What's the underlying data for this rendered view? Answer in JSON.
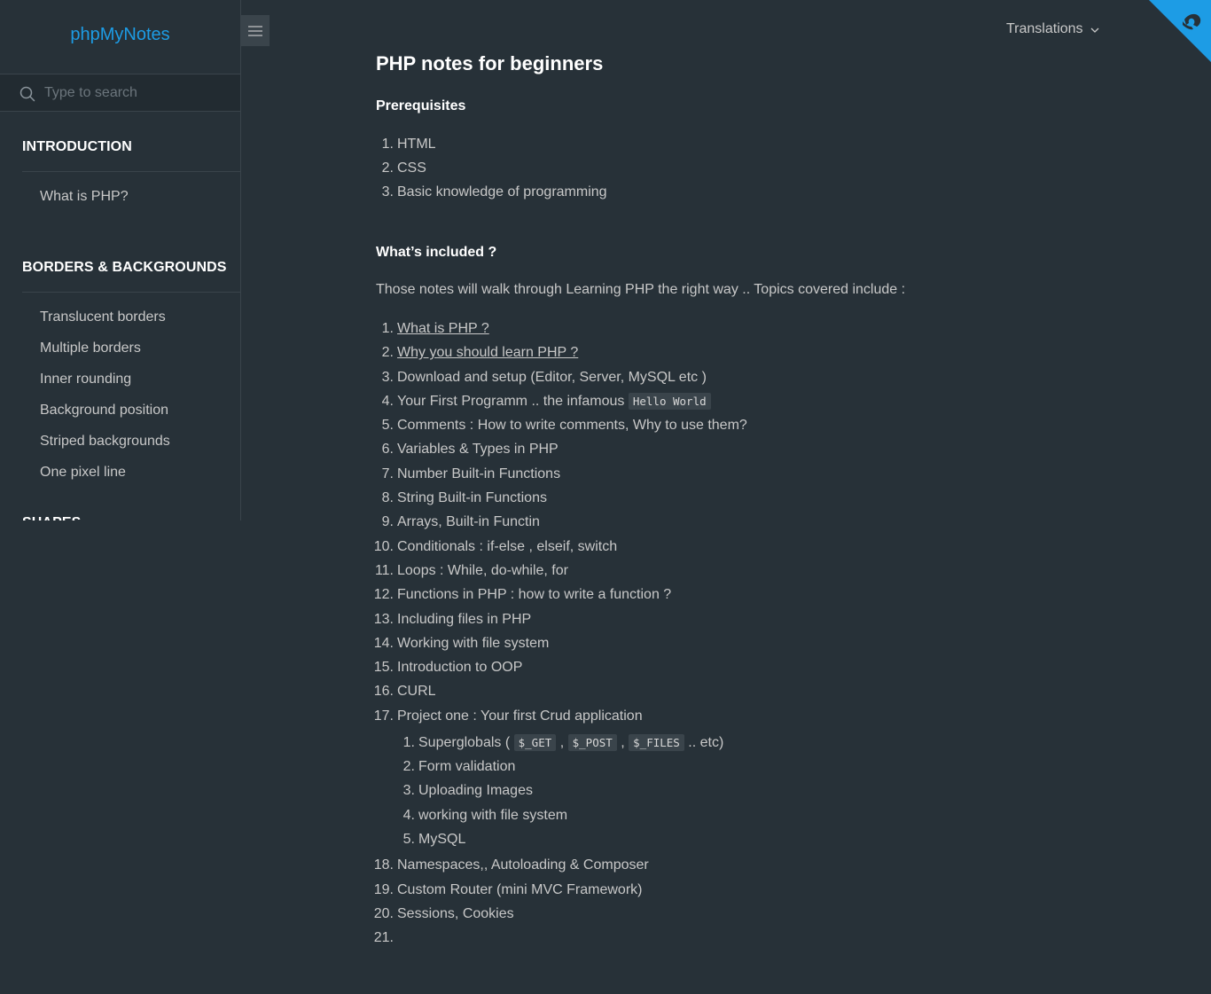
{
  "app": {
    "name": "phpMyNotes"
  },
  "search": {
    "placeholder": "Type to search"
  },
  "sidebar": {
    "sections": [
      {
        "title": "INTRODUCTION",
        "items": [
          "What is PHP?"
        ]
      },
      {
        "title": "BORDERS & BACKGROUNDS",
        "items": [
          "Translucent borders",
          "Multiple borders",
          "Inner rounding",
          "Background position",
          "Striped backgrounds",
          "One pixel line"
        ]
      },
      {
        "title": "SHAPES",
        "items": []
      }
    ]
  },
  "header": {
    "translations_label": "Translations"
  },
  "colors": {
    "background": "#273138",
    "accent": "#1d9ce5",
    "heading": "#ffffff",
    "text": "#c8c8c8",
    "code_bg": "#3a444b"
  },
  "icons": {
    "search": "search-icon",
    "menu": "hamburger-menu-icon",
    "dropdown": "chevron-down-icon",
    "corner": "github-corner-icon"
  },
  "main": {
    "title": "PHP notes for beginners",
    "prerequisites": {
      "heading": "Prerequisites",
      "items": [
        "HTML",
        "CSS",
        "Basic knowledge of programming"
      ]
    },
    "included": {
      "heading": "What’s included ?",
      "intro": "Those notes will walk through Learning PHP the right way .. Topics covered include :",
      "topics": [
        "What is PHP ?",
        "Why you should learn PHP ?",
        "Download and setup (Editor, Server, MySQL etc )",
        "Your First Programm .. the infamous",
        "Comments : How to write comments, Why to use them?",
        "Variables & Types in PHP",
        "Number Built-in Functions",
        "String Built-in Functions",
        "Arrays, Built-in Functin",
        "Conditionals : if-else , elseif, switch",
        "Loops : While, do-while, for",
        "Functions in PHP : how to write a function ?",
        "Including files in PHP",
        "Working with file system",
        "Introduction to OOP",
        "CURL",
        "Project one : Your first Crud application",
        "Namespaces,, Autoloading & Composer",
        "Custom Router (mini MVC Framework)",
        "Sessions, Cookies",
        ""
      ],
      "topic4_code": "Hello World",
      "project_subtopics": {
        "superglobals_prefix": "Superglobals (",
        "superglobals_codes": [
          "$_GET",
          "$_POST",
          "$_FILES"
        ],
        "superglobals_separator": ",",
        "superglobals_suffix": ".. etc)",
        "others": [
          "Form validation",
          "Uploading Images",
          "working with file system",
          "MySQL"
        ]
      },
      "numbers": [
        "1.",
        "2.",
        "3.",
        "4.",
        "5.",
        "6.",
        "7.",
        "8.",
        "9.",
        "10.",
        "11.",
        "12.",
        "13.",
        "14.",
        "15.",
        "16.",
        "17.",
        "18.",
        "19.",
        "20.",
        "21."
      ]
    }
  }
}
